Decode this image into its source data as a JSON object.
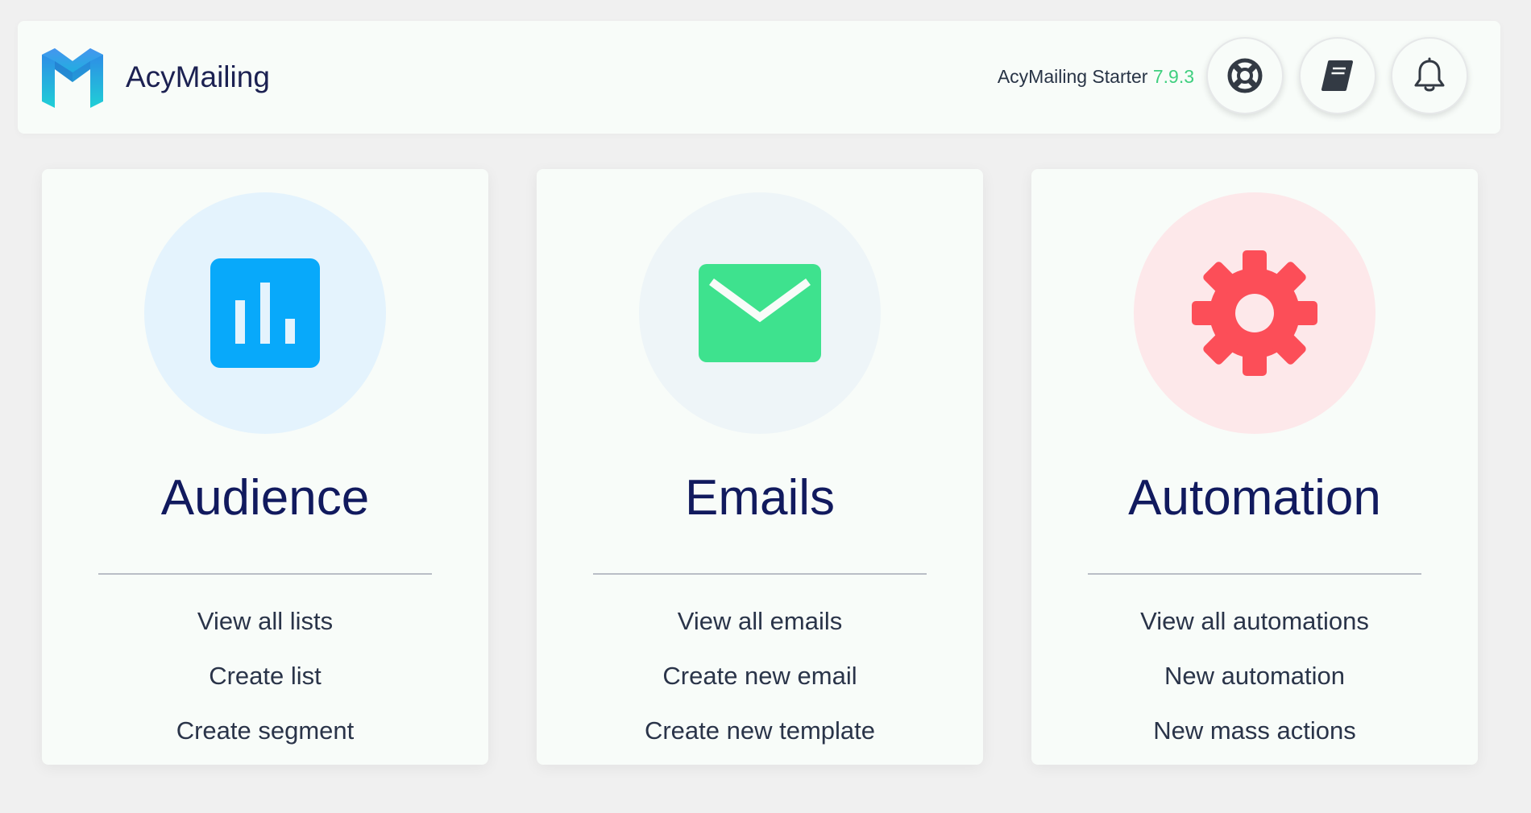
{
  "header": {
    "app_name": "AcyMailing",
    "edition_label": "AcyMailing Starter ",
    "version": "7.9.3",
    "buttons": {
      "support_icon": "lifebuoy-icon",
      "docs_icon": "book-icon",
      "notifications_icon": "bell-icon"
    }
  },
  "colors": {
    "accent_green": "#3fcf7f",
    "audience_blue": "#08a9fa",
    "emails_green": "#3ee28e",
    "automation_red": "#fc4e58",
    "title_navy": "#111a5e"
  },
  "cards": [
    {
      "title": "Audience",
      "icon": "bar-chart-icon",
      "links": [
        "View all lists",
        "Create list",
        "Create segment"
      ]
    },
    {
      "title": "Emails",
      "icon": "envelope-icon",
      "links": [
        "View all emails",
        "Create new email",
        "Create new template"
      ]
    },
    {
      "title": "Automation",
      "icon": "gear-icon",
      "links": [
        "View all automations",
        "New automation",
        "New mass actions"
      ]
    }
  ]
}
